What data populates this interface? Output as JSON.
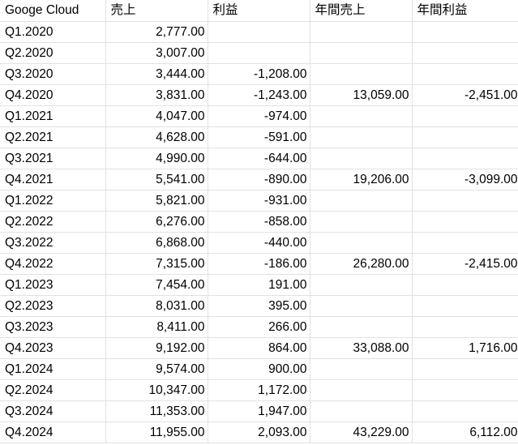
{
  "sheet": {
    "headers": [
      "Googe Cloud",
      "売上",
      "利益",
      "年間売上",
      "年間利益"
    ],
    "rows": [
      {
        "quarter": "Q1.2020",
        "revenue": "2,777.00",
        "profit": "",
        "annual_revenue": "",
        "annual_profit": ""
      },
      {
        "quarter": "Q2.2020",
        "revenue": "3,007.00",
        "profit": "",
        "annual_revenue": "",
        "annual_profit": ""
      },
      {
        "quarter": "Q3.2020",
        "revenue": "3,444.00",
        "profit": "-1,208.00",
        "annual_revenue": "",
        "annual_profit": ""
      },
      {
        "quarter": "Q4.2020",
        "revenue": "3,831.00",
        "profit": "-1,243.00",
        "annual_revenue": "13,059.00",
        "annual_profit": "-2,451.00"
      },
      {
        "quarter": "Q1.2021",
        "revenue": "4,047.00",
        "profit": "-974.00",
        "annual_revenue": "",
        "annual_profit": ""
      },
      {
        "quarter": "Q2.2021",
        "revenue": "4,628.00",
        "profit": "-591.00",
        "annual_revenue": "",
        "annual_profit": ""
      },
      {
        "quarter": "Q3.2021",
        "revenue": "4,990.00",
        "profit": "-644.00",
        "annual_revenue": "",
        "annual_profit": ""
      },
      {
        "quarter": "Q4.2021",
        "revenue": "5,541.00",
        "profit": "-890.00",
        "annual_revenue": "19,206.00",
        "annual_profit": "-3,099.00"
      },
      {
        "quarter": "Q1.2022",
        "revenue": "5,821.00",
        "profit": "-931.00",
        "annual_revenue": "",
        "annual_profit": ""
      },
      {
        "quarter": "Q2.2022",
        "revenue": "6,276.00",
        "profit": "-858.00",
        "annual_revenue": "",
        "annual_profit": ""
      },
      {
        "quarter": "Q3.2022",
        "revenue": "6,868.00",
        "profit": "-440.00",
        "annual_revenue": "",
        "annual_profit": ""
      },
      {
        "quarter": "Q4.2022",
        "revenue": "7,315.00",
        "profit": "-186.00",
        "annual_revenue": "26,280.00",
        "annual_profit": "-2,415.00"
      },
      {
        "quarter": "Q1.2023",
        "revenue": "7,454.00",
        "profit": "191.00",
        "annual_revenue": "",
        "annual_profit": ""
      },
      {
        "quarter": "Q2.2023",
        "revenue": "8,031.00",
        "profit": "395.00",
        "annual_revenue": "",
        "annual_profit": ""
      },
      {
        "quarter": "Q3.2023",
        "revenue": "8,411.00",
        "profit": "266.00",
        "annual_revenue": "",
        "annual_profit": ""
      },
      {
        "quarter": "Q4.2023",
        "revenue": "9,192.00",
        "profit": "864.00",
        "annual_revenue": "33,088.00",
        "annual_profit": "1,716.00"
      },
      {
        "quarter": "Q1.2024",
        "revenue": "9,574.00",
        "profit": "900.00",
        "annual_revenue": "",
        "annual_profit": ""
      },
      {
        "quarter": "Q2.2024",
        "revenue": "10,347.00",
        "profit": "1,172.00",
        "annual_revenue": "",
        "annual_profit": ""
      },
      {
        "quarter": "Q3.2024",
        "revenue": "11,353.00",
        "profit": "1,947.00",
        "annual_revenue": "",
        "annual_profit": ""
      },
      {
        "quarter": "Q4.2024",
        "revenue": "11,955.00",
        "profit": "2,093.00",
        "annual_revenue": "43,229.00",
        "annual_profit": "6,112.00"
      }
    ]
  }
}
